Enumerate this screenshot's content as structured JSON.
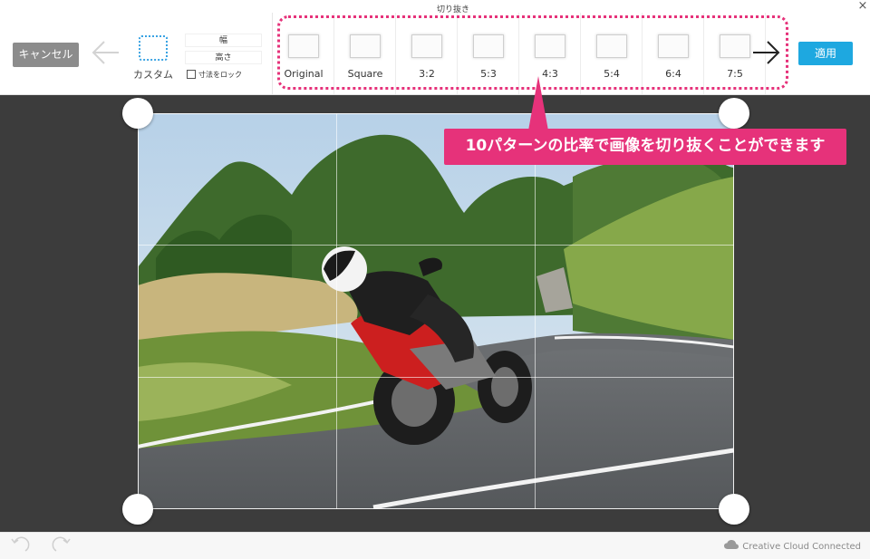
{
  "toolbar": {
    "cancel_label": "キャンセル",
    "custom_label": "カスタム",
    "width_placeholder": "幅",
    "height_placeholder": "高さ",
    "lock_label": "寸法をロック",
    "crop_title": "切り抜き",
    "apply_label": "適用",
    "close_symbol": "×",
    "back_icon": "arrow-left-icon",
    "forward_icon": "arrow-right-icon"
  },
  "ratios": [
    {
      "label": "Original"
    },
    {
      "label": "Square"
    },
    {
      "label": "3:2"
    },
    {
      "label": "5:3"
    },
    {
      "label": "4:3"
    },
    {
      "label": "5:4"
    },
    {
      "label": "6:4"
    },
    {
      "label": "7:5"
    }
  ],
  "callout": {
    "text": "10パターンの比率で画像を切り抜くことができます"
  },
  "statusbar": {
    "cc_status": "Creative Cloud Connected",
    "undo_icon": "undo-icon",
    "redo_icon": "redo-icon"
  },
  "colors": {
    "apply_accent": "#1ea8e0",
    "annotation_pink": "#e6327a",
    "cancel_gray": "#8c8c8c",
    "canvas_dark": "#3c3c3c"
  }
}
